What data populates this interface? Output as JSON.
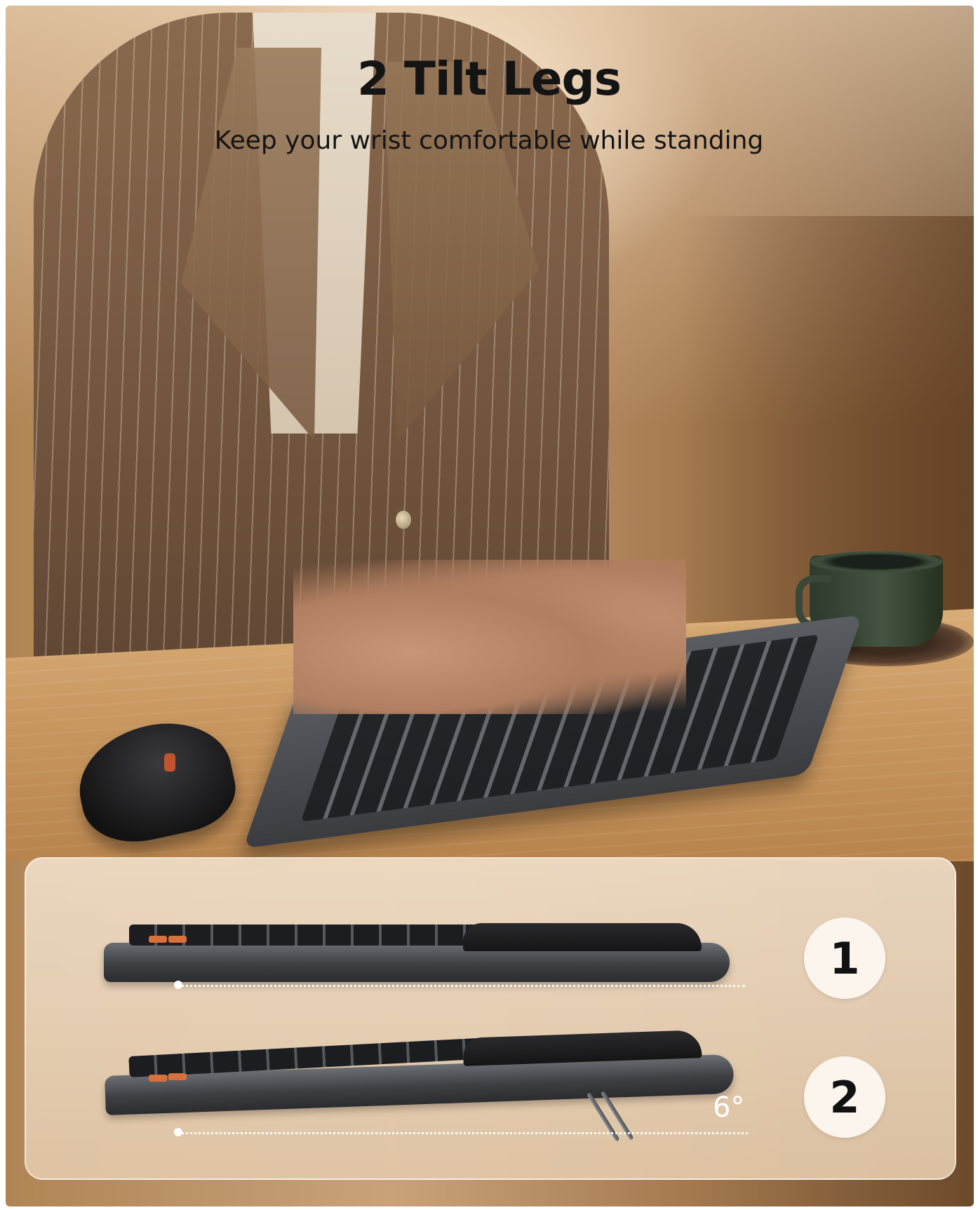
{
  "header": {
    "title": "2 Tilt Legs",
    "subtitle": "Keep your wrist comfortable while standing"
  },
  "panel": {
    "angle_label": "6°",
    "steps": [
      {
        "label": "1"
      },
      {
        "label": "2"
      }
    ]
  },
  "colors": {
    "text": "#141414",
    "badge_bg": "#fbf5ee",
    "panel_bg": "#e6cdb0",
    "accent_orange": "#d8703b"
  }
}
